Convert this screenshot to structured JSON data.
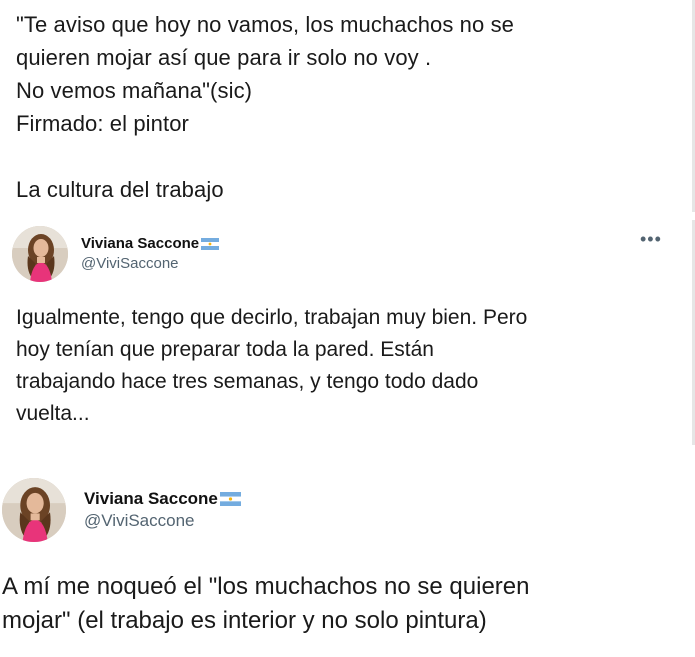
{
  "tweet_top": {
    "text": "\"Te aviso que hoy no vamos, los muchachos no se\nquieren mojar así que para ir solo no voy .\nNo vemos mañana\"(sic)\nFirmado: el pintor\n\nLa cultura del trabajo"
  },
  "tweet_mid": {
    "display_name": "Viviana Saccone",
    "handle": "@ViviSaccone",
    "more_icon": "•••",
    "text": "Igualmente, tengo que decirlo, trabajan muy bien. Pero\nhoy tenían que preparar toda la pared. Están\ntrabajando hace tres semanas, y tengo todo dado\nvuelta..."
  },
  "tweet_bot": {
    "display_name": "Viviana Saccone",
    "handle": "@ViviSaccone",
    "text": "A mí me noqueó el \"los muchachos no se quieren\nmojar\" (el trabajo es interior y no solo pintura)"
  },
  "icons": {
    "flag": "argentina-flag-icon",
    "more": "more-options-icon",
    "avatar": "avatar"
  },
  "colors": {
    "text": "#1a1a1a",
    "handle": "#536471",
    "flag_blue": "#74acdf",
    "flag_sun": "#f6b40e",
    "avatar_dress": "#e8347a"
  }
}
